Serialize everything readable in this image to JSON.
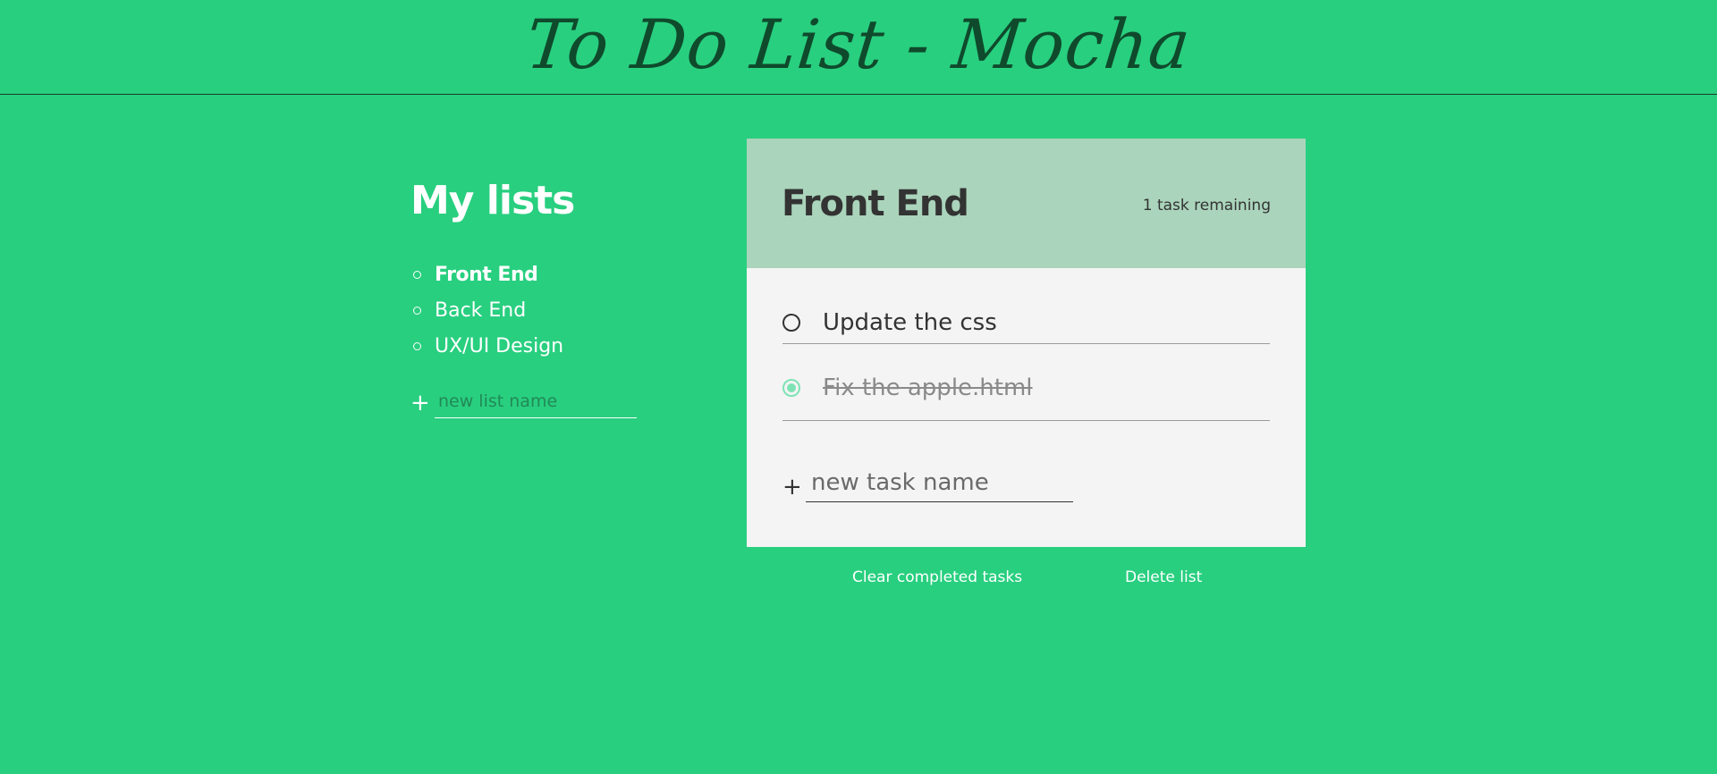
{
  "app": {
    "title": "To Do List - Mocha"
  },
  "sidebar": {
    "title": "My lists",
    "items": [
      {
        "label": "Front End",
        "active": true
      },
      {
        "label": "Back End",
        "active": false
      },
      {
        "label": "UX/UI Design",
        "active": false
      }
    ],
    "new_list": {
      "plus": "+",
      "placeholder": "new list name",
      "value": ""
    }
  },
  "list": {
    "title": "Front End",
    "remaining": "1 task remaining",
    "tasks": [
      {
        "label": "Update the css",
        "completed": false
      },
      {
        "label": "Fix the apple.html",
        "completed": true
      }
    ],
    "new_task": {
      "plus": "+",
      "placeholder": "new task name",
      "value": ""
    }
  },
  "actions": {
    "clear_label": "Clear completed tasks",
    "delete_label": "Delete list"
  },
  "colors": {
    "background": "#28cf7f",
    "title": "#0f4a2c",
    "card_header": "#aad4bb",
    "card_body": "#f4f4f4",
    "completed_check": "#7ee3b4",
    "text_dark": "#333333"
  }
}
